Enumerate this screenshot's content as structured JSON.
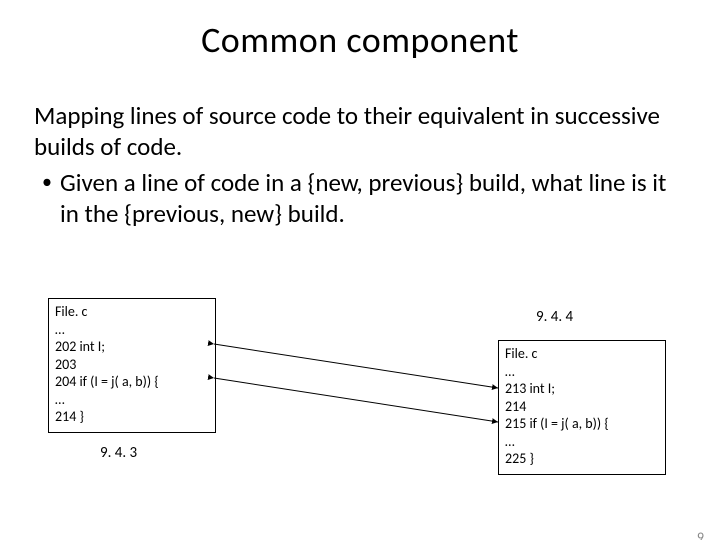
{
  "title": "Common component",
  "para1": "Mapping lines of source code to their equivalent in successive builds of code.",
  "bullet1": "Given a line of code in a {new, previous} build, what line is it in the {previous, new} build.",
  "left_box": {
    "filename": "File. c",
    "l1": "…",
    "l2": "202 int I;",
    "l3": "203",
    "l4": "204 if (I = j( a, b)) {",
    "l5": "…",
    "l6": "214 }"
  },
  "right_box": {
    "filename": "File. c",
    "l1": "…",
    "l2": "213 int I;",
    "l3": "214",
    "l4": "215 if (I = j( a, b)) {",
    "l5": "…",
    "l6": "225 }"
  },
  "version_left": "9. 4. 3",
  "version_right": "9. 4. 4",
  "slide_number": "9"
}
